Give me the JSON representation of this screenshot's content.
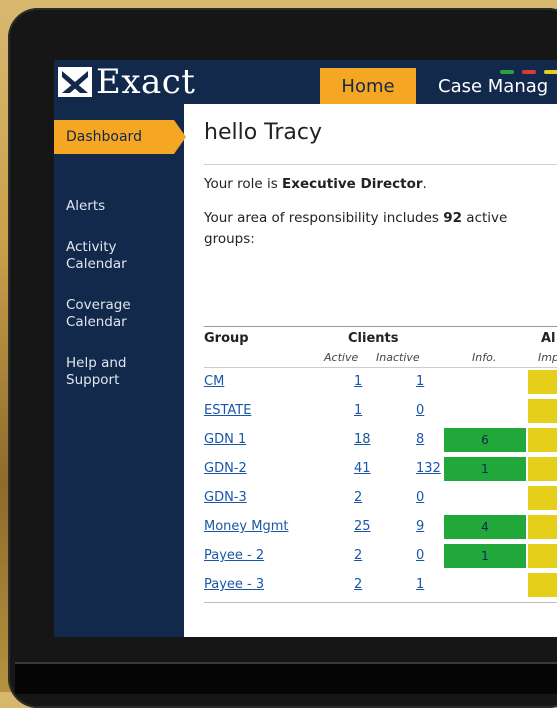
{
  "header": {
    "logo_text": "Exact",
    "tabs": {
      "home": "Home",
      "case": "Case Manag"
    },
    "status_dots": [
      "#2ea043",
      "#d93b3b",
      "#e6cf1a"
    ]
  },
  "sidebar": {
    "active": "Dashboard",
    "items": [
      "Alerts",
      "Activity Calendar",
      "Coverage Calendar",
      "Help and Support"
    ]
  },
  "main": {
    "greeting": "hello Tracy",
    "role_prefix": "Your role is ",
    "role": "Executive Director",
    "role_suffix": ".",
    "area_prefix": "Your area of responsibility includes ",
    "area_count": "92",
    "area_suffix": " active",
    "area_line2": "groups:"
  },
  "table": {
    "headers": {
      "group": "Group",
      "clients": "Clients",
      "alerts": "Al"
    },
    "subheaders": {
      "active": "Active",
      "inactive": "Inactive",
      "info": "Info.",
      "imp": "Imp"
    },
    "rows": [
      {
        "group": "CM",
        "active": "1",
        "inactive": "1",
        "info": ""
      },
      {
        "group": "ESTATE",
        "active": "1",
        "inactive": "0",
        "info": ""
      },
      {
        "group": "GDN 1",
        "active": "18",
        "inactive": "8",
        "info": "6"
      },
      {
        "group": "GDN-2",
        "active": "41",
        "inactive": "132",
        "info": "1"
      },
      {
        "group": "GDN-3",
        "active": "2",
        "inactive": "0",
        "info": ""
      },
      {
        "group": "Money Mgmt",
        "active": "25",
        "inactive": "9",
        "info": "4"
      },
      {
        "group": "Payee - 2",
        "active": "2",
        "inactive": "0",
        "info": "1"
      },
      {
        "group": "Payee - 3",
        "active": "2",
        "inactive": "1",
        "info": ""
      }
    ]
  },
  "colors": {
    "navy": "#13294b",
    "orange": "#f5a623",
    "green": "#22a83a",
    "yellow": "#e6cf1a",
    "link": "#1a56a8"
  }
}
